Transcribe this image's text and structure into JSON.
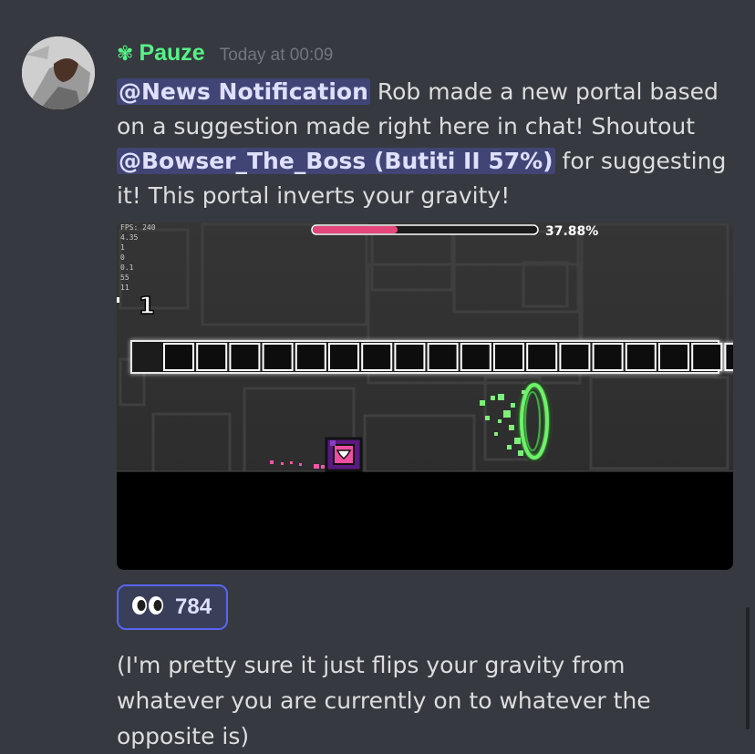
{
  "message": {
    "username": "Pauze",
    "role_icon": "clover-icon",
    "timestamp": "Today at 00:09",
    "mention_1": "@News Notification",
    "text_1": " Rob made a new portal based on a suggestion made right here in chat! Shoutout ",
    "mention_2": "@Bowser_The_Boss (Butiti II 57%)",
    "text_2": " for suggesting it! This portal inverts your gravity!"
  },
  "embed": {
    "progress_text": "37.88%",
    "progress_fraction": 0.3788,
    "attempt_number": "1",
    "stats_lines": [
      "FPS: 240",
      "4.35",
      "1",
      "0",
      "0.1",
      "55",
      "11"
    ]
  },
  "reaction": {
    "emoji": "👀",
    "count": "784"
  },
  "followup": {
    "text": "(I'm pretty sure it just flips your gravity from whatever you are currently on to whatever the opposite is)"
  },
  "colors": {
    "username": "#57f287",
    "mention_bg": "#5865f2",
    "background": "#36393f"
  }
}
